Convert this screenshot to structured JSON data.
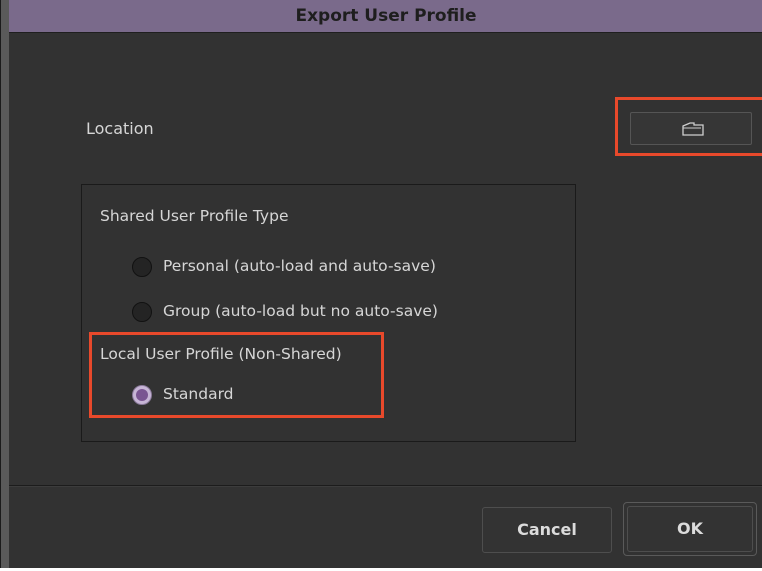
{
  "window": {
    "title": "Export User Profile"
  },
  "location": {
    "label": "Location",
    "browse_icon": "folder-icon"
  },
  "profile_type": {
    "shared_heading": "Shared User Profile Type",
    "options": [
      {
        "label": "Personal (auto-load and auto-save)",
        "checked": false
      },
      {
        "label": "Group (auto-load but no auto-save)",
        "checked": false
      }
    ],
    "local_heading": "Local User Profile (Non-Shared)",
    "local_option": {
      "label": "Standard",
      "checked": true
    }
  },
  "buttons": {
    "cancel": "Cancel",
    "ok": "OK"
  },
  "colors": {
    "titlebar": "#7a6a8b",
    "background": "#323232",
    "highlight": "#e8492b",
    "radio_selected": "#7a5592"
  }
}
